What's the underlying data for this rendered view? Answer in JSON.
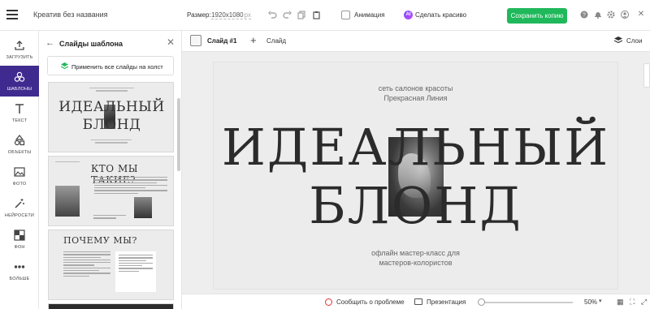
{
  "header": {
    "doc_title": "Креатив без названия",
    "size_label": "Размер:",
    "size_value": "1920x1080",
    "size_unit": "px",
    "animation_label": "Анимация",
    "ai_badge": "AI",
    "ai_label": "Сделать красиво",
    "save_label": "Сохранить копию"
  },
  "rail": {
    "upload": "ЗАГРУЗИТЬ",
    "templates": "ШАБЛОНЫ",
    "text": "ТЕКСТ",
    "objects": "ОБЪЕКТЫ",
    "photo": "ФОТО",
    "ai": "НЕЙРОСЕТИ",
    "background": "ФОН",
    "more": "БОЛЬШЕ"
  },
  "panel": {
    "title": "Слайды шаблона",
    "apply_label": "Применить все слайды на холст",
    "thumb1": {
      "line1": "ИДЕАЛЬНЫЙ",
      "line2": "БЛОНД"
    },
    "thumb2": {
      "title": "КТО МЫ ТАКИЕ?"
    },
    "thumb3": {
      "title": "ПОЧЕМУ МЫ?"
    }
  },
  "canvas": {
    "slide_name": "Слайд #1",
    "add_slide": "Слайд",
    "layers_label": "Слои"
  },
  "slide": {
    "sub_top_1": "сеть салонов красоты",
    "sub_top_2": "Прекрасная Линия",
    "title_1": "ИДЕАЛЬНЫЙ",
    "title_2": "БЛОНД",
    "sub_bottom_1": "офлайн мастер-класс для",
    "sub_bottom_2": "мастеров-колористов"
  },
  "footer": {
    "report_label": "Сообщить о проблеме",
    "presentation_label": "Презентация",
    "zoom": "50%"
  },
  "colors": {
    "primary": "#1fb85a",
    "active_rail": "#3f2b8f"
  }
}
